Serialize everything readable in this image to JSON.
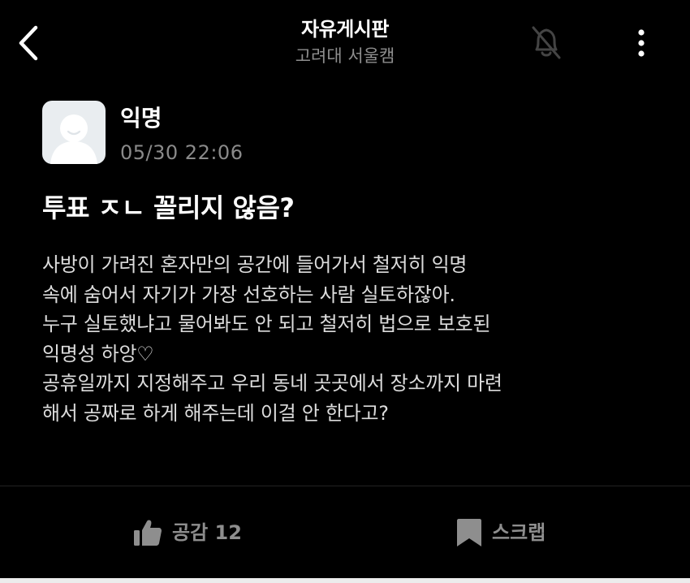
{
  "header": {
    "back_icon": "chevron-left-icon",
    "title": "자유게시판",
    "subtitle": "고려대 서울캠",
    "bell_icon": "bell-off-icon",
    "more_icon": "more-vertical-icon"
  },
  "post": {
    "author": "익명",
    "avatar_icon": "anonymous-avatar-icon",
    "timestamp": "05/30 22:06",
    "title": "투표 ㅈㄴ 꼴리지 않음?",
    "body_lines": [
      "사방이 가려진 혼자만의 공간에 들어가서 철저히 익명",
      "속에 숨어서 자기가 가장 선호하는 사람 실토하잖아.",
      "누구 실토했냐고 물어봐도 안 되고 철저히 법으로 보호된",
      "익명성 하앙♡",
      "공휴일까지 지정해주고 우리 동네 곳곳에서 장소까지 마련",
      "해서 공짜로 하게 해주는데 이걸 안 한다고?"
    ]
  },
  "actions": {
    "like_label": "공감 12",
    "like_icon": "thumbs-up-icon",
    "scrap_label": "스크랩",
    "scrap_icon": "bookmark-icon"
  },
  "colors": {
    "background": "#000000",
    "text": "#ffffff",
    "muted": "#8e8e8e",
    "body_text": "#dcdcdc",
    "avatar_bg": "#e9edf0"
  }
}
